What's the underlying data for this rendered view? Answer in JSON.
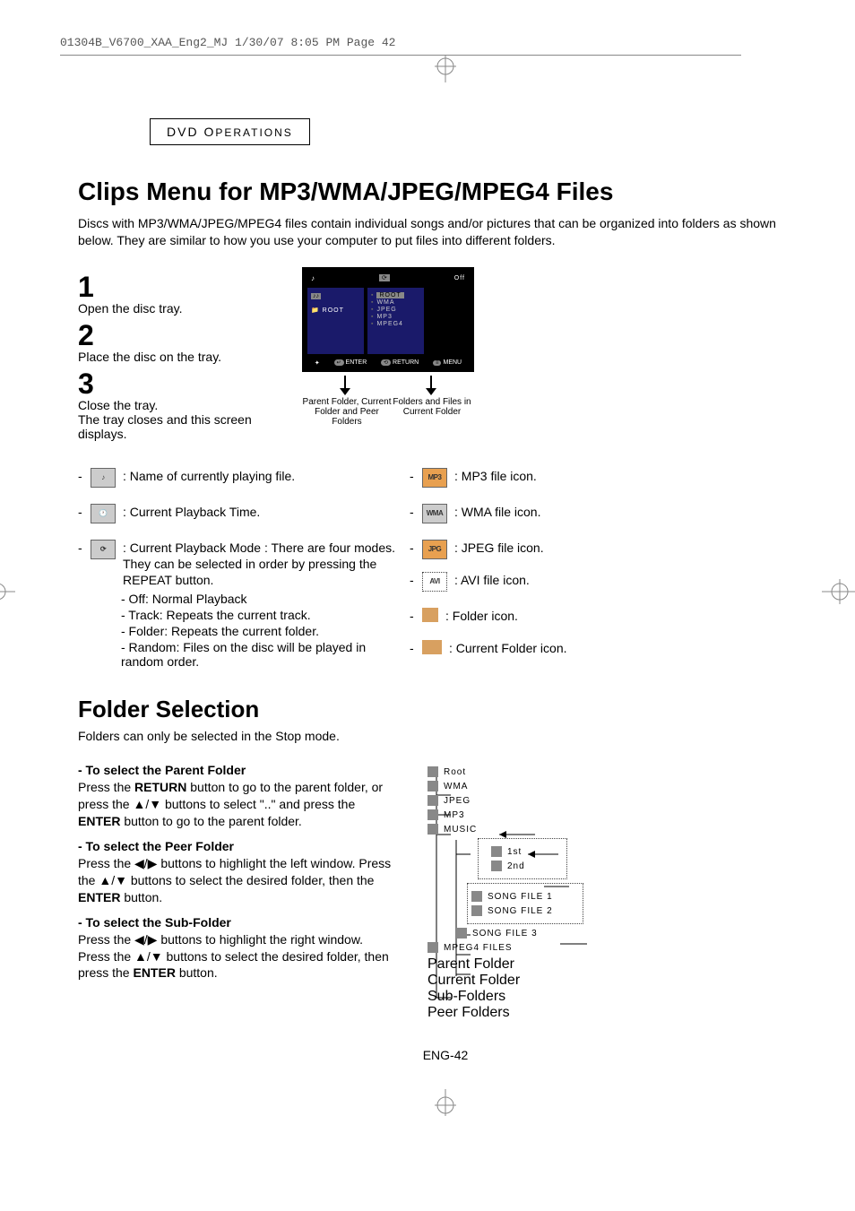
{
  "print_header": "01304B_V6700_XAA_Eng2_MJ  1/30/07  8:05 PM  Page 42",
  "section_label_1": "DVD O",
  "section_label_2": "PERATIONS",
  "main_title": "Clips Menu for MP3/WMA/JPEG/MPEG4 Files",
  "intro": "Discs with MP3/WMA/JPEG/MPEG4 files contain individual songs and/or pictures that can be organized into folders as shown below.  They are similar to how you use your computer to put files into different folders.",
  "steps": [
    {
      "num": "1",
      "text": "Open the disc tray."
    },
    {
      "num": "2",
      "text": "Place the disc on the tray."
    },
    {
      "num": "3",
      "text": "Close the tray.\nThe tray closes and this screen displays."
    }
  ],
  "osd": {
    "off": "Off",
    "left_root": "ROOT",
    "right": [
      "ROOT",
      "WMA",
      "JPEG",
      "MP3",
      "MPEG4"
    ],
    "bottom_enter": "ENTER",
    "bottom_return": "RETURN",
    "bottom_menu": "MENU"
  },
  "osd_labels": {
    "left": "Parent Folder, Current Folder and Peer Folders",
    "right": "Folders and Files in Current Folder"
  },
  "left_items": [
    {
      "text": ":  Name of currently playing file."
    },
    {
      "text": ":  Current Playback Time."
    },
    {
      "text": ": Current Playback Mode : There are four modes. They can be selected in order by pressing the REPEAT button."
    }
  ],
  "left_sub": [
    "- Off: Normal Playback",
    "- Track: Repeats the current track.",
    "- Folder: Repeats the current folder.",
    "- Random: Files on the disc will be played in random order."
  ],
  "right_items": [
    {
      "label": "MP3",
      "class": "orange",
      "text": ": MP3 file icon."
    },
    {
      "label": "WMA",
      "class": "",
      "text": ": WMA file icon."
    },
    {
      "label": "JPG",
      "class": "orange",
      "text": ": JPEG file icon."
    },
    {
      "label": "AVI",
      "class": "dotted",
      "text": ": AVI file icon."
    },
    {
      "label": "",
      "class": "plain",
      "text": ": Folder icon."
    },
    {
      "label": "",
      "class": "plain",
      "text": ": Current Folder icon."
    }
  ],
  "folder_title": "Folder Selection",
  "folder_intro": "Folders can only be selected in the Stop mode.",
  "fs": [
    {
      "h": "- To select the Parent Folder",
      "p": "Press the <b>RETURN</b> button to go to the parent folder, or press the ▲/▼ buttons to select \"..\" and press the <b>ENTER</b> button to go to the parent folder."
    },
    {
      "h": "- To select the Peer Folder",
      "p": "Press the ◀/▶ buttons to highlight the left window. Press the ▲/▼ buttons to select the desired folder, then the <b>ENTER</b> button."
    },
    {
      "h": "- To select the Sub-Folder",
      "p": "Press the ◀/▶ buttons to highlight the right window. Press the ▲/▼ buttons to select the desired folder, then press the <b>ENTER</b> button."
    }
  ],
  "tree": {
    "root": "Root",
    "nodes": [
      "WMA",
      "JPEG",
      "MP3",
      "MUSIC",
      "1st",
      "2nd",
      "SONG FILE 1",
      "SONG FILE 2",
      "SONG FILE 3",
      "MPEG4 FILES"
    ],
    "labels": {
      "parent": "Parent Folder",
      "current": "Current Folder",
      "sub": "Sub-Folders",
      "peer": "Peer Folders"
    }
  },
  "page_num": "ENG-42"
}
